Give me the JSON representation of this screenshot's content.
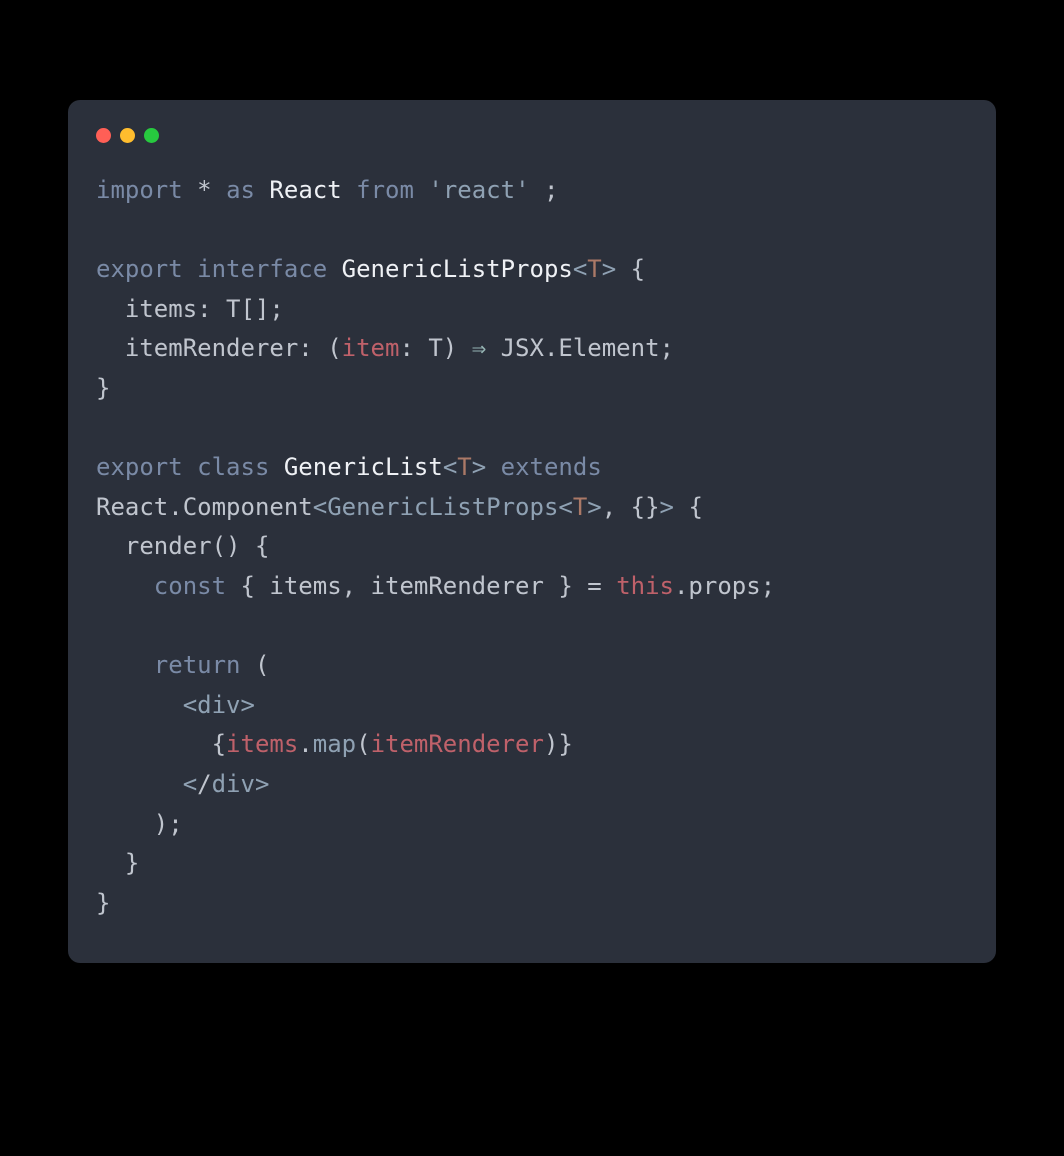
{
  "code": {
    "tokens": [
      [
        [
          "import",
          "t-kw"
        ],
        [
          " ",
          "t-def"
        ],
        [
          "*",
          "t-def"
        ],
        [
          " ",
          "t-def"
        ],
        [
          "as",
          "t-kw"
        ],
        [
          " ",
          "t-def"
        ],
        [
          "React",
          "t-name"
        ],
        [
          " ",
          "t-def"
        ],
        [
          "from",
          "t-kw"
        ],
        [
          " ",
          "t-def"
        ],
        [
          "'react'",
          "t-str"
        ],
        [
          " ;",
          "t-def"
        ]
      ],
      [],
      [
        [
          "export",
          "t-kw"
        ],
        [
          " ",
          "t-def"
        ],
        [
          "interface",
          "t-kw"
        ],
        [
          " ",
          "t-def"
        ],
        [
          "GenericListProps",
          "t-name"
        ],
        [
          "<",
          "t-ang"
        ],
        [
          "T",
          "t-tp"
        ],
        [
          ">",
          "t-ang"
        ],
        [
          " {",
          "t-def"
        ]
      ],
      [
        [
          "  items: T[];",
          "t-def"
        ]
      ],
      [
        [
          "  itemRenderer: (",
          "t-def"
        ],
        [
          "item",
          "t-param"
        ],
        [
          ": T) ",
          "t-def"
        ],
        [
          "⇒",
          "t-arrow"
        ],
        [
          " JSX.Element;",
          "t-def"
        ]
      ],
      [
        [
          "}",
          "t-def"
        ]
      ],
      [],
      [
        [
          "export",
          "t-kw"
        ],
        [
          " ",
          "t-def"
        ],
        [
          "class",
          "t-kw"
        ],
        [
          " ",
          "t-def"
        ],
        [
          "GenericList",
          "t-name"
        ],
        [
          "<",
          "t-ang"
        ],
        [
          "T",
          "t-tp"
        ],
        [
          ">",
          "t-ang"
        ],
        [
          " ",
          "t-def"
        ],
        [
          "extends",
          "t-kw"
        ]
      ],
      [
        [
          "React.Component",
          "t-def"
        ],
        [
          "<",
          "t-ang"
        ],
        [
          "GenericListProps",
          "t-fn"
        ],
        [
          "<",
          "t-ang"
        ],
        [
          "T",
          "t-tp"
        ],
        [
          ">",
          "t-ang"
        ],
        [
          ", {}",
          "t-def"
        ],
        [
          ">",
          "t-ang"
        ],
        [
          " {",
          "t-def"
        ]
      ],
      [
        [
          "  render() {",
          "t-def"
        ]
      ],
      [
        [
          "    ",
          "t-def"
        ],
        [
          "const",
          "t-kw"
        ],
        [
          " { items, itemRenderer } = ",
          "t-def"
        ],
        [
          "this",
          "t-this"
        ],
        [
          ".props;",
          "t-def"
        ]
      ],
      [],
      [
        [
          "    ",
          "t-def"
        ],
        [
          "return",
          "t-kw"
        ],
        [
          " (",
          "t-def"
        ]
      ],
      [
        [
          "      ",
          "t-def"
        ],
        [
          "<",
          "t-ang"
        ],
        [
          "div",
          "t-fn"
        ],
        [
          ">",
          "t-ang"
        ]
      ],
      [
        [
          "        {",
          "t-def"
        ],
        [
          "items",
          "t-items"
        ],
        [
          ".",
          "t-def"
        ],
        [
          "map",
          "t-fn"
        ],
        [
          "(",
          "t-def"
        ],
        [
          "itemRenderer",
          "t-render"
        ],
        [
          ")}",
          "t-def"
        ]
      ],
      [
        [
          "      ",
          "t-def"
        ],
        [
          "<",
          "t-ang"
        ],
        [
          "/",
          "t-def"
        ],
        [
          "div",
          "t-fn"
        ],
        [
          ">",
          "t-ang"
        ]
      ],
      [
        [
          "    );",
          "t-def"
        ]
      ],
      [
        [
          "  }",
          "t-def"
        ]
      ],
      [
        [
          "}",
          "t-def"
        ]
      ]
    ],
    "plain": "import * as React from 'react' ;\n\nexport interface GenericListProps<T> {\n  items: T[];\n  itemRenderer: (item: T) => JSX.Element;\n}\n\nexport class GenericList<T> extends\nReact.Component<GenericListProps<T>, {}> {\n  render() {\n    const { items, itemRenderer } = this.props;\n\n    return (\n      <div>\n        {items.map(itemRenderer)}\n      </div>\n    );\n  }\n}"
  },
  "window": {
    "dots": [
      "close",
      "minimize",
      "zoom"
    ]
  }
}
